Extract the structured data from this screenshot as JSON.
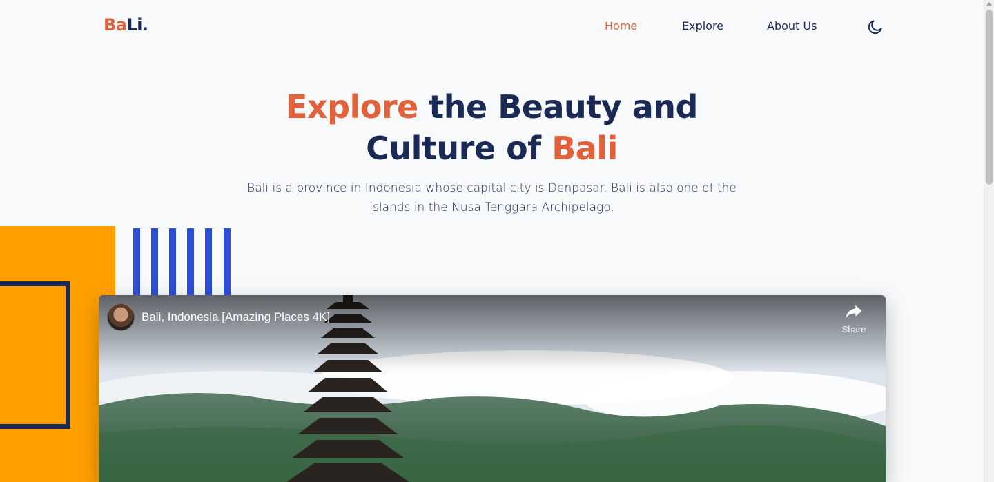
{
  "logo": {
    "part1": "Ba",
    "part2": "Li."
  },
  "nav": {
    "home": "Home",
    "explore": "Explore",
    "about": "About Us",
    "theme_icon": "moon-icon"
  },
  "hero": {
    "line1_accent": "Explore",
    "line1_rest": "the Beauty and",
    "line2_start": "Culture of",
    "line2_accent": "Bali",
    "subtitle_line1": "Bali is a province in Indonesia whose capital city is Denpasar. Bali is also one of the",
    "subtitle_line2": "islands in the Nusa Tenggara Archipelago."
  },
  "video": {
    "title": "Bali, Indonesia [Amazing Places 4K]",
    "share_label": "Share",
    "share_icon": "share-icon"
  },
  "colors": {
    "accent": "#e1613a",
    "navy": "#1b2a55",
    "orange_block": "#ffa000",
    "stripe_blue": "#2f4fd8",
    "background": "#f7f9fb"
  }
}
